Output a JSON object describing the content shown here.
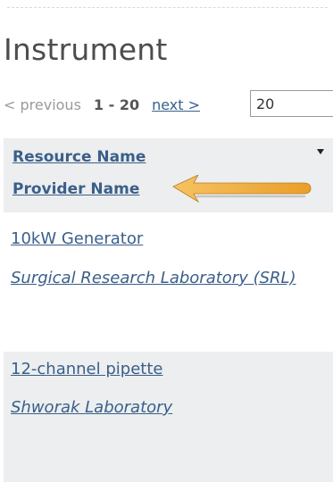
{
  "page": {
    "title": "Instrument"
  },
  "pager": {
    "previous_label": "< previous",
    "range_label": "1 - 20",
    "next_label": "next >",
    "per_page_value": "20"
  },
  "table": {
    "columns": {
      "resource_name": "Resource Name",
      "provider_name": "Provider Name"
    },
    "sort_icon": "caret-down-icon",
    "rows": [
      {
        "resource": "10kW Generator",
        "provider": "Surgical Research Laboratory (SRL)"
      },
      {
        "resource": "12-channel pipette",
        "provider": "Shworak Laboratory"
      }
    ]
  },
  "annotation": {
    "icon": "arrow-left-icon",
    "color": "#f0a531"
  },
  "colors": {
    "link": "#3a5f8a",
    "header_bg": "#eceeef",
    "title_text": "#4d4d4d",
    "muted_text": "#9a9a9a"
  }
}
